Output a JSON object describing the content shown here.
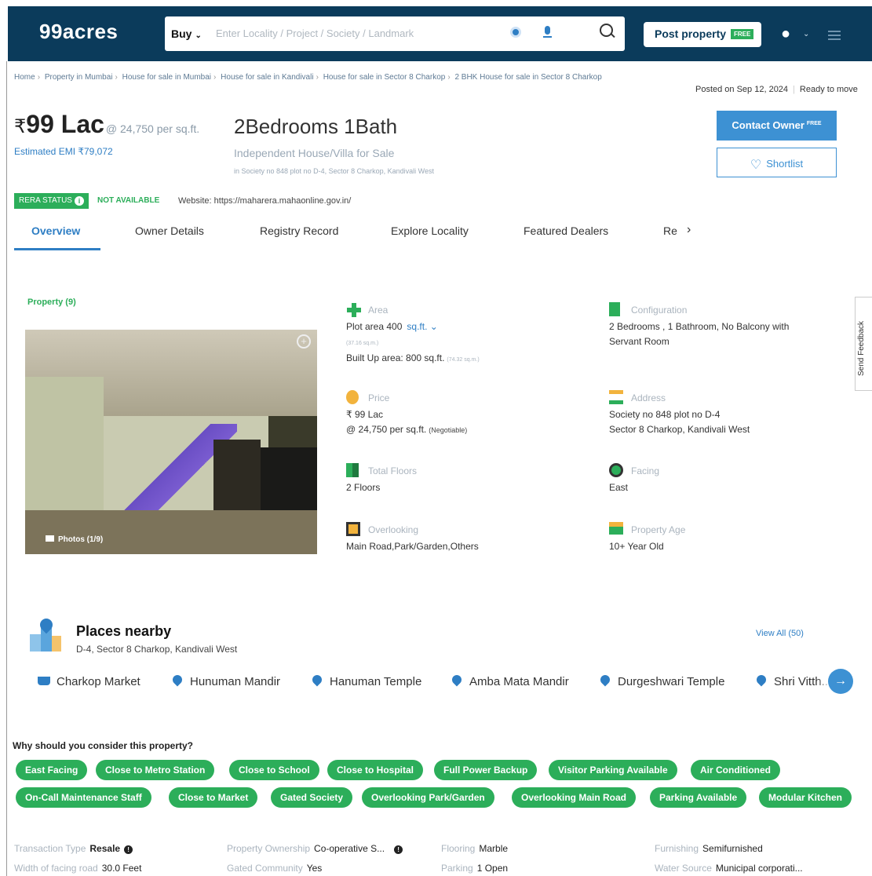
{
  "header": {
    "logo": "99acres",
    "buy_label": "Buy",
    "search_placeholder": "Enter Locality / Project / Society / Landmark",
    "post_property_label": "Post property",
    "free_tag": "FREE"
  },
  "breadcrumb": {
    "items": [
      "Home",
      "Property in Mumbai",
      "House for sale in Mumbai",
      "House for sale in Kandivali",
      "House for sale in Sector 8 Charkop",
      "2 BHK House for sale in Sector 8 Charkop"
    ]
  },
  "posted": {
    "date": "Posted on Sep 12, 2024",
    "status": "Ready to move"
  },
  "listing": {
    "rupee": "₹",
    "price": "99 Lac",
    "price_per_sqft": "@ 24,750 per sq.ft.",
    "emi": "Estimated EMI ₹79,072",
    "title": "2Bedrooms 1Bath",
    "subtitle": "Independent House/Villa for Sale",
    "address_small": "in Society no 848 plot no D-4, Sector 8 Charkop, Kandivali West",
    "contact_label": "Contact Owner",
    "contact_free": "FREE",
    "shortlist_label": "Shortlist"
  },
  "rera": {
    "badge": "RERA STATUS",
    "status": "NOT AVAILABLE",
    "website": "Website: https://maharera.mahaonline.gov.in/"
  },
  "tabs": [
    {
      "label": "Overview"
    },
    {
      "label": "Owner Details"
    },
    {
      "label": "Registry Record"
    },
    {
      "label": "Explore Locality"
    },
    {
      "label": "Featured Dealers"
    },
    {
      "label": "Re"
    }
  ],
  "property": {
    "count_label": "Property (9)",
    "photos_label": "Photos (1/9)"
  },
  "details": {
    "area_label": "Area",
    "area_plot": "Plot area 400",
    "area_unit": "sq.ft.",
    "area_plot_sqm": "(37.16 sq.m.)",
    "area_built": "Built Up area: 800 sq.ft.",
    "area_built_sqm": "(74.32 sq.m.)",
    "config_label": "Configuration",
    "config_line1": "2 Bedrooms , 1 Bathroom, No Balcony with",
    "config_line2": "Servant Room",
    "price_label": "Price",
    "price_value": "₹ 99 Lac",
    "price_psf": "@ 24,750 per sq.ft.",
    "price_neg": "(Negotiable)",
    "address_label": "Address",
    "address_line1": "Society no 848 plot no D-4",
    "address_line2": "Sector 8 Charkop, Kandivali West",
    "floors_label": "Total Floors",
    "floors_value": "2 Floors",
    "facing_label": "Facing",
    "facing_value": "East",
    "overlooking_label": "Overlooking",
    "overlooking_value": "Main Road,Park/Garden,Others",
    "age_label": "Property Age",
    "age_value": "10+ Year Old"
  },
  "feedback": "Send Feedback",
  "places": {
    "title": "Places nearby",
    "subtitle": "D-4, Sector 8 Charkop, Kandivali West",
    "view_all": "View All (50)",
    "items": [
      "Charkop Market",
      "Hunuman Mandir",
      "Hanuman Temple",
      "Amba Mata Mandir",
      "Durgeshwari Temple",
      "Shri Vitth..."
    ]
  },
  "why": {
    "title": "Why should you consider this property?",
    "chips": [
      "East Facing",
      "Close to Metro Station",
      "Close to School",
      "Close to Hospital",
      "Full Power Backup",
      "Visitor Parking Available",
      "Air Conditioned",
      "On-Call Maintenance Staff",
      "Close to Market",
      "Gated Society",
      "Overlooking Park/Garden",
      "Overlooking Main Road",
      "Parking Available",
      "Modular Kitchen"
    ]
  },
  "facts": {
    "transaction_label": "Transaction Type",
    "transaction_value": "Resale",
    "ownership_label": "Property Ownership",
    "ownership_value": "Co-operative S...",
    "flooring_label": "Flooring",
    "flooring_value": "Marble",
    "furnishing_label": "Furnishing",
    "furnishing_value": "Semifurnished",
    "road_label": "Width of facing road",
    "road_value": "30.0 Feet",
    "gated_label": "Gated Community",
    "gated_value": "Yes",
    "parking_label": "Parking",
    "parking_value": "1 Open",
    "water_label": "Water Source",
    "water_value": "Municipal corporati..."
  }
}
